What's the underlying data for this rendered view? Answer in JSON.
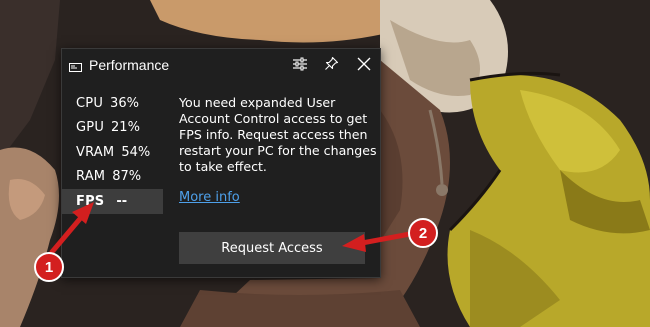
{
  "widget": {
    "title": "Performance",
    "title_icon": "monitor-icon",
    "buttons": {
      "settings_icon": "sliders-icon",
      "pin_icon": "pin-icon",
      "close_icon": "close-icon"
    },
    "metrics": [
      {
        "label": "CPU",
        "value": "36%"
      },
      {
        "label": "GPU",
        "value": "21%"
      },
      {
        "label": "VRAM",
        "value": "54%"
      },
      {
        "label": "RAM",
        "value": "87%"
      },
      {
        "label": "FPS",
        "value": "--",
        "selected": true
      }
    ],
    "message": "You need expanded User Account Control access to get FPS info. Request access then restart your PC for the changes to take effect.",
    "more_info_label": "More info",
    "request_button_label": "Request Access"
  },
  "annotations": {
    "badge_1": "1",
    "badge_2": "2",
    "color": "#d31f1f"
  },
  "colors": {
    "panel": "#1f1f1f",
    "selected_row": "#3d3d3d",
    "button": "#3f3f3f",
    "link": "#4ea0ea"
  }
}
